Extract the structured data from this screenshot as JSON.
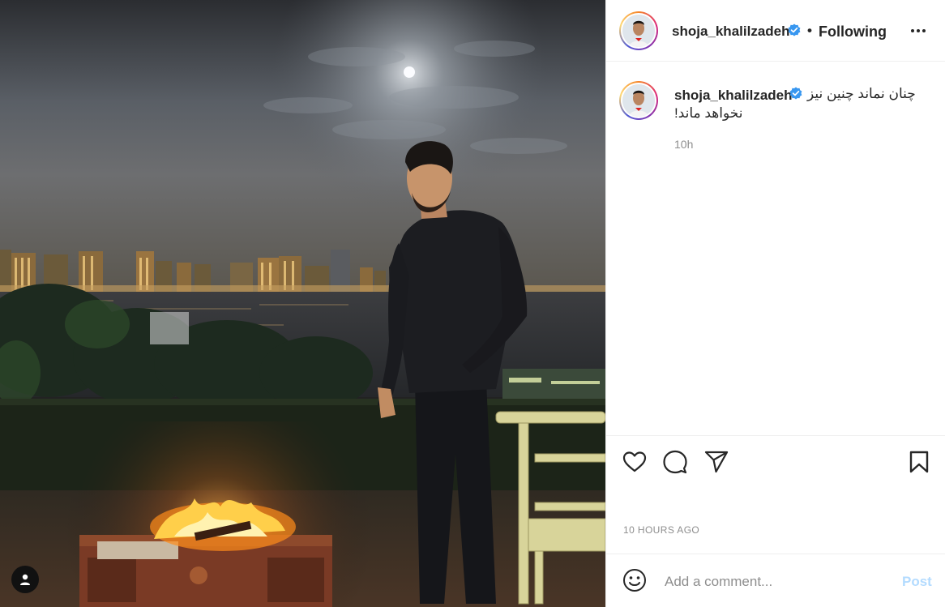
{
  "post": {
    "username": "shoja_khalilzadeh",
    "follow_status": "Following",
    "caption_line1": "چنان نماند چنین نیز",
    "caption_line2": "نخواهد ماند!",
    "caption_time": "10h",
    "posted_ago": "10 HOURS AGO"
  },
  "comment": {
    "placeholder": "Add a comment...",
    "post_label": "Post"
  },
  "icons": {
    "verified": "verified-badge-icon",
    "more": "more-options-icon",
    "like": "heart-icon",
    "comment": "comment-icon",
    "share": "share-icon",
    "save": "bookmark-icon",
    "emoji": "emoji-icon",
    "tag": "user-tag-icon"
  },
  "colors": {
    "verified": "#3897f0",
    "post_disabled": "#b3dbff",
    "muted_text": "#8e8e8e"
  }
}
